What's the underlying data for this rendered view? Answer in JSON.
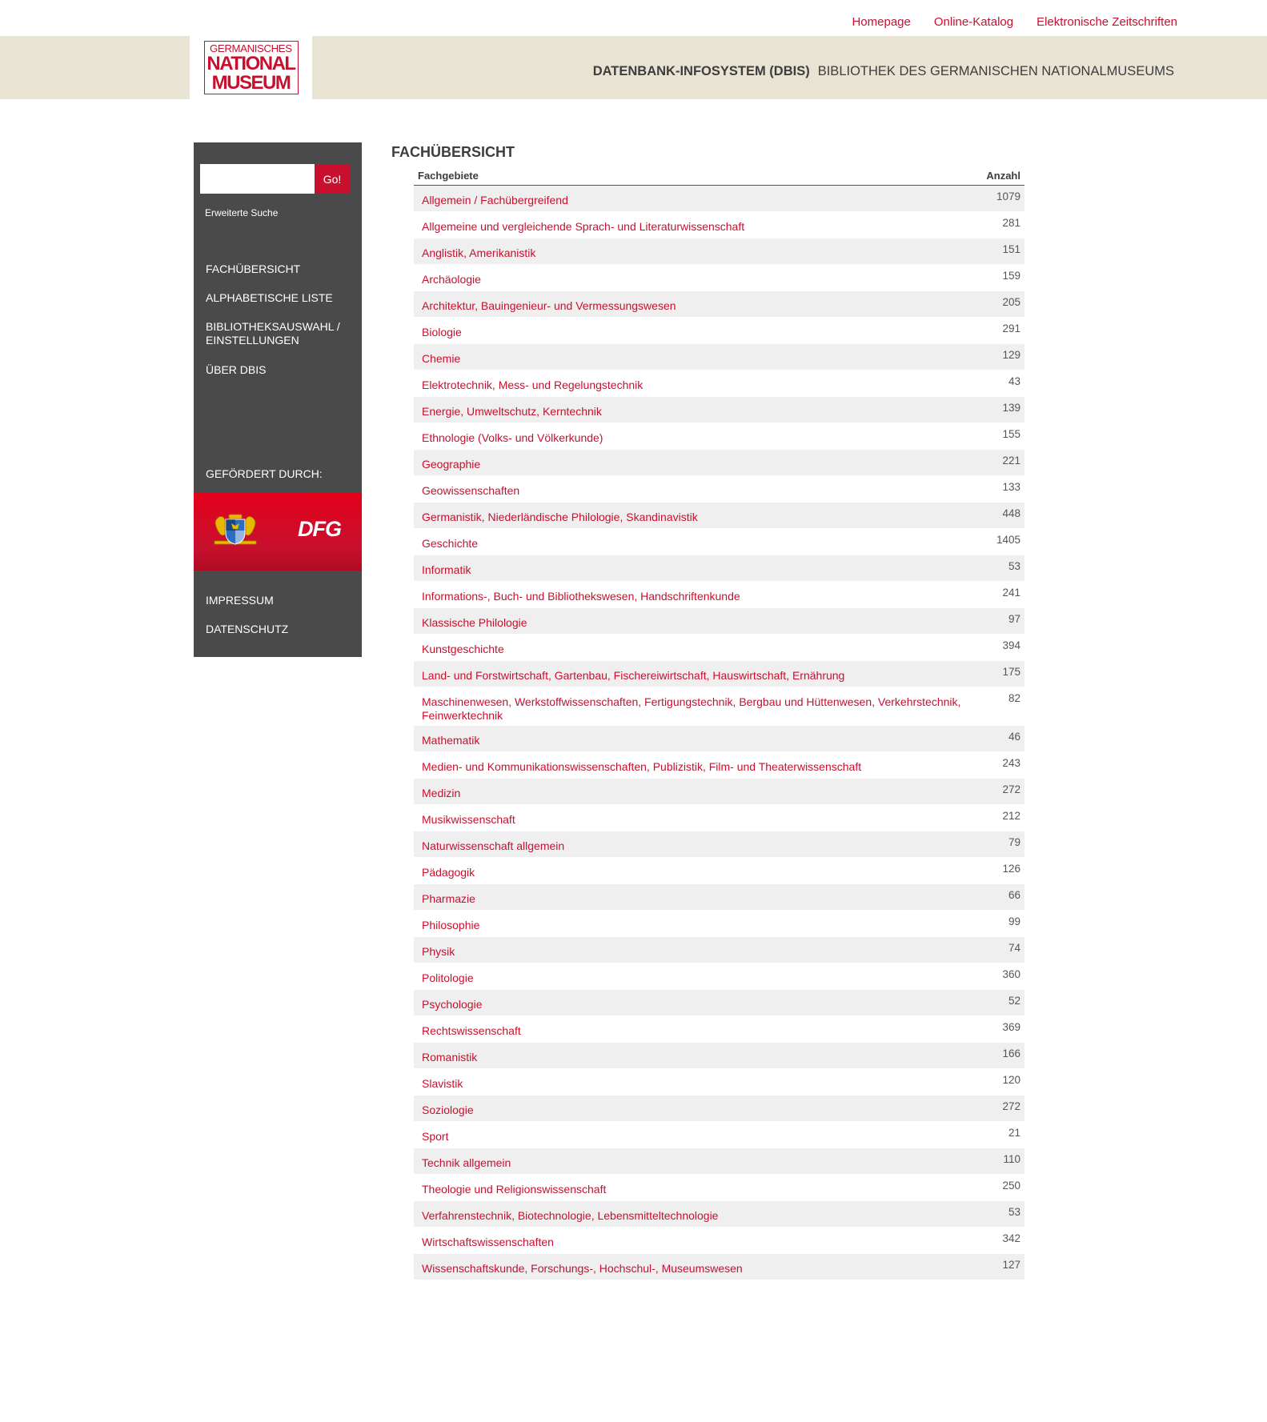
{
  "topnav": [
    {
      "label": "Homepage"
    },
    {
      "label": "Online-Katalog"
    },
    {
      "label": "Elektronische Zeitschriften"
    }
  ],
  "logo": {
    "line1": "GERMANISCHES",
    "line2": "NATIONAL",
    "line3": "MUSEUM"
  },
  "banner": {
    "title_bold": "DATENBANK-INFOSYSTEM (DBIS)",
    "title_rest": "BIBLIOTHEK DES GERMANISCHEN NATIONALMUSEUMS"
  },
  "sidebar": {
    "search_value": "",
    "search_button": "Go!",
    "advanced_search": "Erweiterte Suche",
    "menu": [
      {
        "label": "FACHÜBERSICHT"
      },
      {
        "label": "ALPHABETISCHE LISTE"
      },
      {
        "label": "BIBLIOTHEKSAUSWAHL / EINSTELLUNGEN"
      },
      {
        "label": "ÜBER DBIS"
      }
    ],
    "funded_by": "GEFÖRDERT DURCH:",
    "sponsor_dfg": "DFG",
    "imprint": "IMPRESSUM",
    "privacy": "DATENSCHUTZ"
  },
  "main": {
    "title": "FACHÜBERSICHT",
    "col_subject": "Fachgebiete",
    "col_count": "Anzahl",
    "rows": [
      {
        "subject": "Allgemein / Fachübergreifend",
        "count": "1079"
      },
      {
        "subject": "Allgemeine und vergleichende Sprach- und Literaturwissenschaft",
        "count": "281"
      },
      {
        "subject": "Anglistik, Amerikanistik",
        "count": "151"
      },
      {
        "subject": "Archäologie",
        "count": "159"
      },
      {
        "subject": "Architektur, Bauingenieur- und Vermessungswesen",
        "count": "205"
      },
      {
        "subject": "Biologie",
        "count": "291"
      },
      {
        "subject": "Chemie",
        "count": "129"
      },
      {
        "subject": "Elektrotechnik, Mess- und Regelungstechnik",
        "count": "43"
      },
      {
        "subject": "Energie, Umweltschutz, Kerntechnik",
        "count": "139"
      },
      {
        "subject": "Ethnologie (Volks- und Völkerkunde)",
        "count": "155"
      },
      {
        "subject": "Geographie",
        "count": "221"
      },
      {
        "subject": "Geowissenschaften",
        "count": "133"
      },
      {
        "subject": "Germanistik, Niederländische Philologie, Skandinavistik",
        "count": "448"
      },
      {
        "subject": "Geschichte",
        "count": "1405"
      },
      {
        "subject": "Informatik",
        "count": "53"
      },
      {
        "subject": "Informations-, Buch- und Bibliothekswesen, Handschriftenkunde",
        "count": "241"
      },
      {
        "subject": "Klassische Philologie",
        "count": "97"
      },
      {
        "subject": "Kunstgeschichte",
        "count": "394"
      },
      {
        "subject": "Land- und Forstwirtschaft, Gartenbau, Fischereiwirtschaft, Hauswirtschaft, Ernährung",
        "count": "175"
      },
      {
        "subject": "Maschinenwesen, Werkstoffwissenschaften, Fertigungstechnik, Bergbau und Hüttenwesen, Verkehrstechnik, Feinwerktechnik",
        "count": "82"
      },
      {
        "subject": "Mathematik",
        "count": "46"
      },
      {
        "subject": "Medien- und Kommunikationswissenschaften, Publizistik, Film- und Theaterwissenschaft",
        "count": "243"
      },
      {
        "subject": "Medizin",
        "count": "272"
      },
      {
        "subject": "Musikwissenschaft",
        "count": "212"
      },
      {
        "subject": "Naturwissenschaft allgemein",
        "count": "79"
      },
      {
        "subject": "Pädagogik",
        "count": "126"
      },
      {
        "subject": "Pharmazie",
        "count": "66"
      },
      {
        "subject": "Philosophie",
        "count": "99"
      },
      {
        "subject": "Physik",
        "count": "74"
      },
      {
        "subject": "Politologie",
        "count": "360"
      },
      {
        "subject": "Psychologie",
        "count": "52"
      },
      {
        "subject": "Rechtswissenschaft",
        "count": "369"
      },
      {
        "subject": "Romanistik",
        "count": "166"
      },
      {
        "subject": "Slavistik",
        "count": "120"
      },
      {
        "subject": "Soziologie",
        "count": "272"
      },
      {
        "subject": "Sport",
        "count": "21"
      },
      {
        "subject": "Technik allgemein",
        "count": "110"
      },
      {
        "subject": "Theologie und Religionswissenschaft",
        "count": "250"
      },
      {
        "subject": "Verfahrenstechnik, Biotechnologie, Lebensmitteltechnologie",
        "count": "53"
      },
      {
        "subject": "Wirtschaftswissenschaften",
        "count": "342"
      },
      {
        "subject": "Wissenschaftskunde, Forschungs-, Hochschul-, Museumswesen",
        "count": "127"
      }
    ]
  },
  "colors": {
    "accent": "#c8102e",
    "banner_bg": "#e9e3d4",
    "sidebar_bg": "#4a4a4a",
    "row_alt": "#efefef"
  }
}
